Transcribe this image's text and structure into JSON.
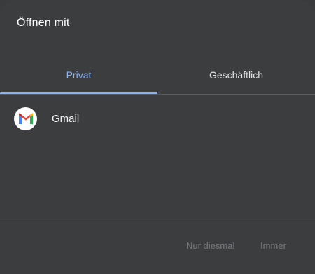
{
  "dialog": {
    "title": "Öffnen mit"
  },
  "tabs": [
    {
      "label": "Privat",
      "selected": true
    },
    {
      "label": "Geschäftlich",
      "selected": false
    }
  ],
  "apps": [
    {
      "label": "Gmail",
      "icon": "gmail-icon"
    }
  ],
  "actions": {
    "just_once_label": "Nur diesmal",
    "always_label": "Immer"
  },
  "colors": {
    "background": "#3c3d3f",
    "accent": "#8ab4f8",
    "disabled_text": "#77797c"
  }
}
